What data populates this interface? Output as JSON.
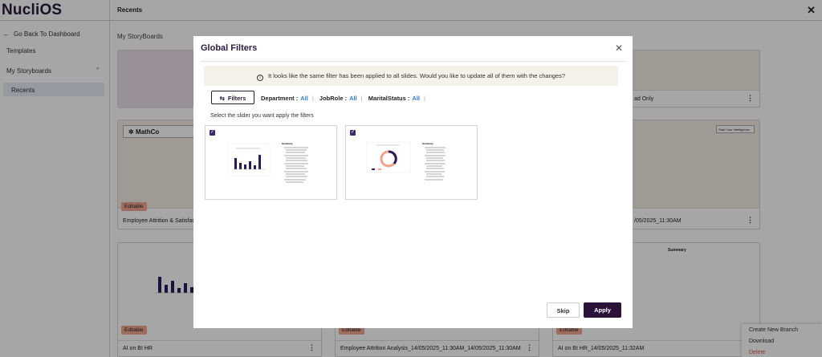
{
  "app": {
    "logo": "NucliOS",
    "page_title": "Recents",
    "close_label": "✕"
  },
  "sidebar": {
    "back_label": "Go Back To Dashboard",
    "templates_label": "Templates",
    "storyboards_label": "My Storyboards",
    "recents_label": "Recents"
  },
  "main": {
    "heading": "My StoryBoards",
    "cards": [
      {
        "title": "ad Only",
        "badge": ""
      },
      {
        "title": "Employee Attrition & Satisfac",
        "badge": "Editable",
        "brand": "MathCo"
      },
      {
        "title": "/05/2025_11:30AM",
        "badge": "",
        "corner_label": "Start Your Intelligence"
      },
      {
        "title": "AI on BI HR",
        "badge": "Editable"
      },
      {
        "title": "Employee Attrition Analysis_14/05/2025_11:30AM_14/05/2025_11:30AM",
        "badge": "Editable"
      },
      {
        "title": "AI on BI HR_14/05/2025_11:32AM",
        "badge": "Editable",
        "summary_label": "Summary"
      }
    ],
    "card_menu": {
      "items": [
        "Create New Branch",
        "Download",
        "Delete"
      ]
    }
  },
  "modal": {
    "title": "Global Filters",
    "notice": "It looks like the same filter has been applied to all slides. Would you like to update all of them with the changes?",
    "filters_button": "Filters",
    "filters": [
      {
        "label": "Department :",
        "value": "All"
      },
      {
        "label": "JobRole :",
        "value": "All"
      },
      {
        "label": "MaritalStatus :",
        "value": "All"
      }
    ],
    "hint": "Select the slider you want apply the filters",
    "slides": [
      {
        "checked": true,
        "chart": "bar",
        "summary_label": "Summary"
      },
      {
        "checked": true,
        "chart": "donut",
        "summary_label": "Summary"
      }
    ],
    "skip_label": "Skip",
    "apply_label": "Apply"
  }
}
